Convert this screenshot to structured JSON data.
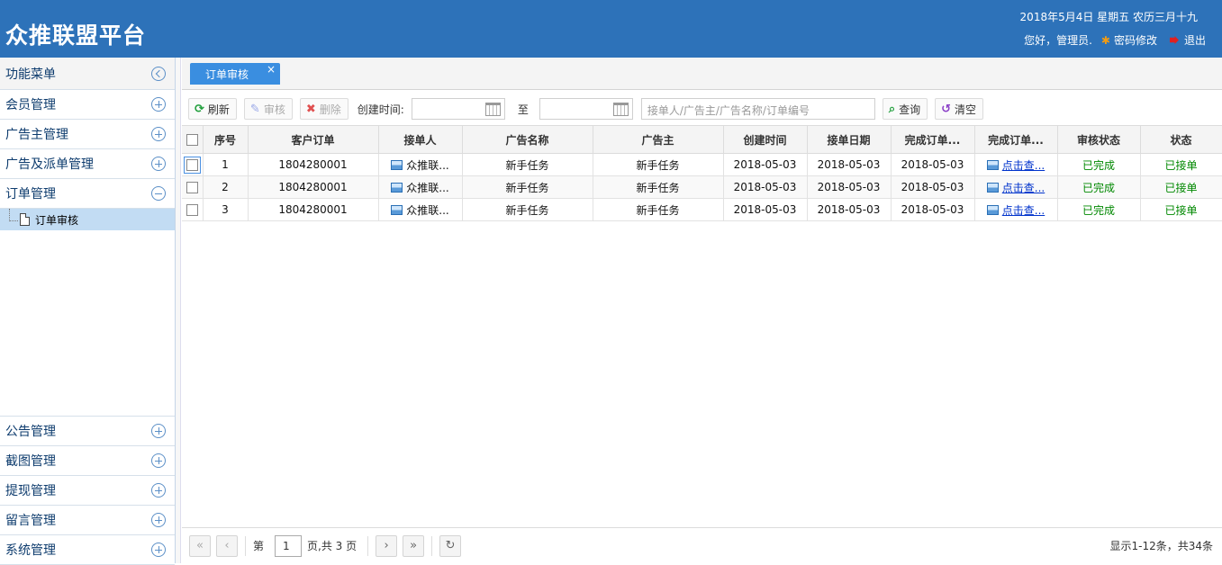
{
  "header": {
    "title": "众推联盟平台",
    "date": "2018年5月4日 星期五 农历三月十九",
    "greeting": "您好，管理员.",
    "change_password": "密码修改",
    "logout": "退出"
  },
  "sidebar": {
    "title": "功能菜单",
    "groups_top": [
      {
        "label": "会员管理"
      },
      {
        "label": "广告主管理"
      },
      {
        "label": "广告及派单管理"
      },
      {
        "label": "订单管理"
      }
    ],
    "active_sub": "订单审核",
    "groups_bottom": [
      {
        "label": "公告管理"
      },
      {
        "label": "截图管理"
      },
      {
        "label": "提现管理"
      },
      {
        "label": "留言管理"
      },
      {
        "label": "系统管理"
      }
    ]
  },
  "tab": {
    "label": "订单审核",
    "close": "×"
  },
  "toolbar": {
    "refresh": "刷新",
    "audit": "审核",
    "delete": "删除",
    "created_label": "创建时间:",
    "to_label": "至",
    "search_placeholder": "接单人/广告主/广告名称/订单编号",
    "query": "查询",
    "clear": "清空"
  },
  "table": {
    "columns": [
      "序号",
      "客户订单",
      "接单人",
      "广告名称",
      "广告主",
      "创建时间",
      "接单日期",
      "完成订单...",
      "完成订单...",
      "审核状态",
      "状态"
    ],
    "rows": [
      {
        "no": "1",
        "order": "1804280001",
        "taker": "众推联...",
        "ad": "新手任务",
        "advertiser": "新手任务",
        "created": "2018-05-03",
        "accepted": "2018-05-03",
        "done": "2018-05-03",
        "shot": "点击查...",
        "audit": "已完成",
        "status": "已接单"
      },
      {
        "no": "2",
        "order": "1804280001",
        "taker": "众推联...",
        "ad": "新手任务",
        "advertiser": "新手任务",
        "created": "2018-05-03",
        "accepted": "2018-05-03",
        "done": "2018-05-03",
        "shot": "点击查...",
        "audit": "已完成",
        "status": "已接单"
      },
      {
        "no": "3",
        "order": "1804280001",
        "taker": "众推联...",
        "ad": "新手任务",
        "advertiser": "新手任务",
        "created": "2018-05-03",
        "accepted": "2018-05-03",
        "done": "2018-05-03",
        "shot": "点击查...",
        "audit": "已完成",
        "status": "已接单"
      }
    ]
  },
  "pager": {
    "page_prefix": "第",
    "page_value": "1",
    "page_suffix": "页,共 3 页",
    "info": "显示1-12条，共34条"
  },
  "colors": {
    "header_bg": "#2d72b9",
    "tab_bg": "#3a8ee0",
    "selected_menu": "#c2dcf3",
    "status_green": "#008800"
  }
}
